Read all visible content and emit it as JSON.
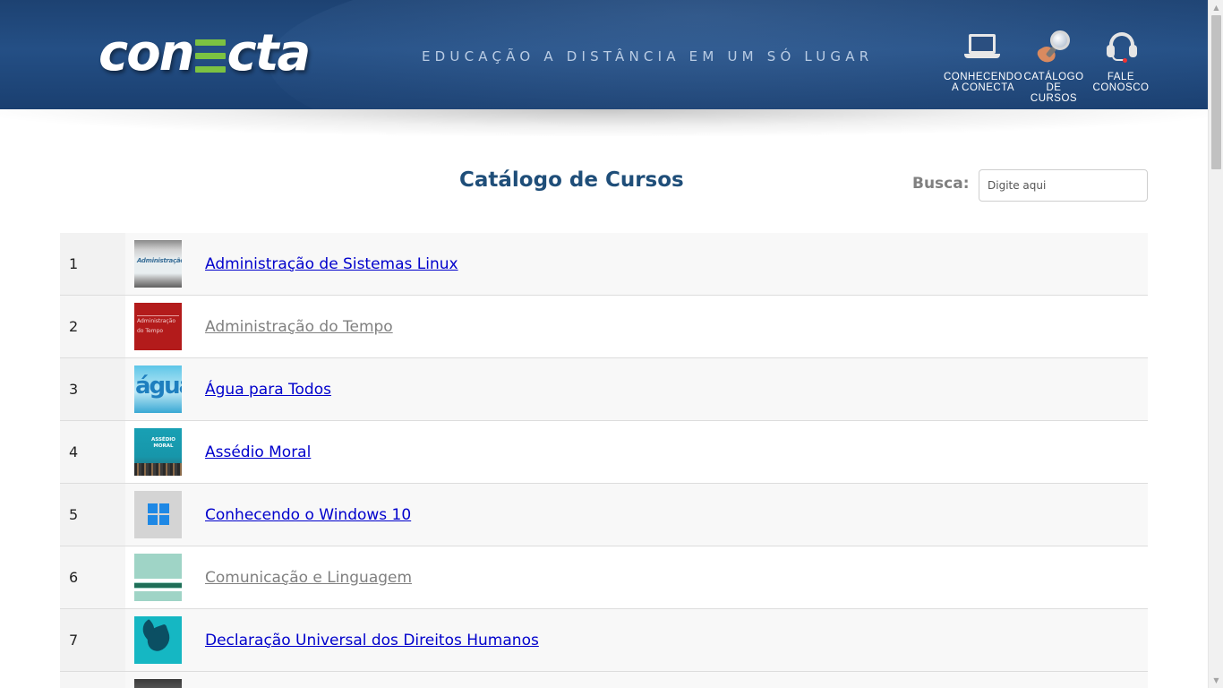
{
  "header": {
    "logo_text_a": "con",
    "logo_text_b": "cta",
    "tagline": "EDUCAÇÃO A DISTÂNCIA EM UM SÓ LUGAR",
    "nav": [
      {
        "label": "CONHECENDO\nA CONECTA",
        "icon": "laptop-icon"
      },
      {
        "label": "CATÁLOGO\nDE\nCURSOS",
        "icon": "magnifier-icon"
      },
      {
        "label": "FALE\nCONOSCO",
        "icon": "headset-icon"
      }
    ]
  },
  "main": {
    "title": "Catálogo de Cursos",
    "search": {
      "label": "Busca:",
      "placeholder": "Digite aqui"
    }
  },
  "courses": [
    {
      "num": "1",
      "title": "Administração de Sistemas Linux",
      "thumb_text": "Administração",
      "visited": false
    },
    {
      "num": "2",
      "title": "Administração do Tempo",
      "thumb_text": "Administração do Tempo",
      "visited": true
    },
    {
      "num": "3",
      "title": "Água para Todos",
      "thumb_text": "água",
      "visited": false
    },
    {
      "num": "4",
      "title": "Assédio Moral",
      "thumb_text": "ASSÉDIO MORAL",
      "visited": false
    },
    {
      "num": "5",
      "title": "Conhecendo o Windows 10",
      "thumb_text": "",
      "visited": false
    },
    {
      "num": "6",
      "title": "Comunicação e Linguagem",
      "thumb_text": "",
      "visited": true
    },
    {
      "num": "7",
      "title": "Declaração Universal dos Direitos Humanos",
      "thumb_text": "",
      "visited": false
    }
  ],
  "colors": {
    "header_bg": "#1f4677",
    "title": "#1f4e79",
    "link": "#0000cc",
    "visited_link": "#808080",
    "logo_accent": "#7cc242"
  }
}
